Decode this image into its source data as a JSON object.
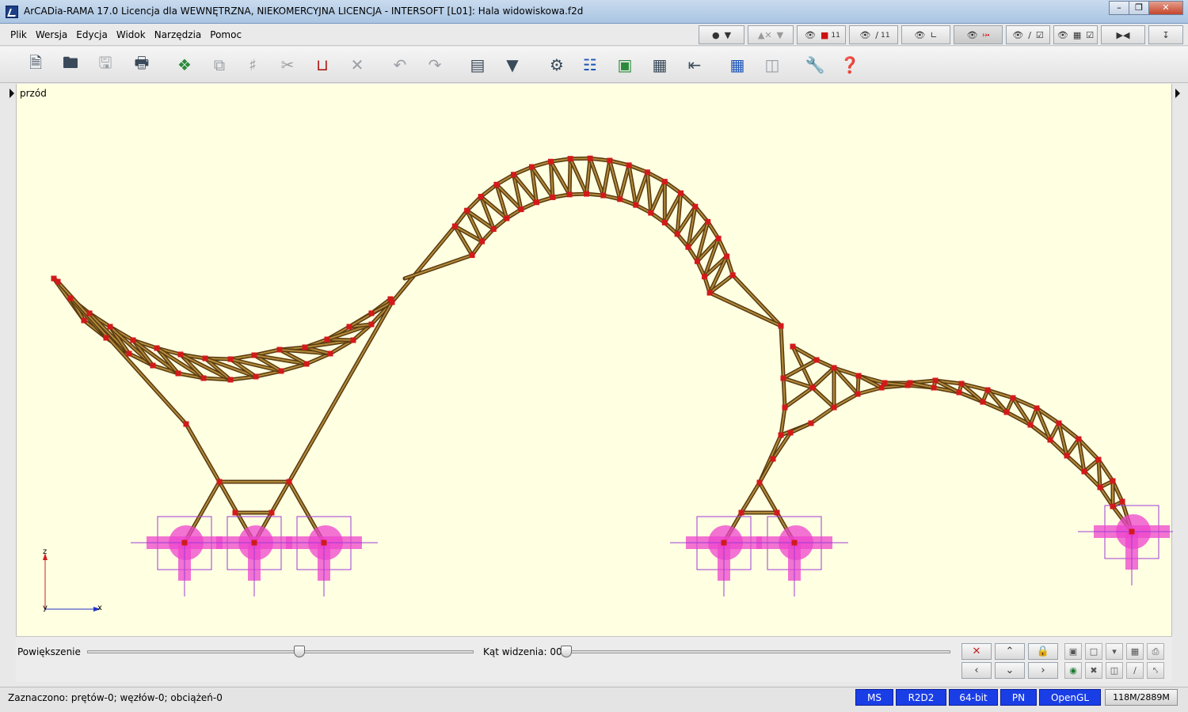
{
  "window": {
    "title": "ArCADia-RAMA 17.0 Licencja dla WEWNĘTRZNA, NIEKOMERCYJNA LICENCJA - INTERSOFT [L01]: Hala widowiskowa.f2d"
  },
  "menu": {
    "items": [
      {
        "label": "Plik"
      },
      {
        "label": "Wersja"
      },
      {
        "label": "Edycja"
      },
      {
        "label": "Widok"
      },
      {
        "label": "Narzędzia"
      },
      {
        "label": "Pomoc"
      }
    ]
  },
  "view_controls": {
    "load_counter": "11",
    "number_label": "11"
  },
  "canvas": {
    "view_name": "przód",
    "axis_z": "z",
    "axis_x": "x",
    "axis_y": "y",
    "colors": {
      "background": "#ffffe1",
      "member": "#5a3a10",
      "member_fill": "#b08a3a",
      "node": "#d21a1a",
      "support": "#ee44cc"
    }
  },
  "controls": {
    "zoom_label": "Powiększenie",
    "angle_label": "Kąt widzenia: 00",
    "zoom_level": 0.55,
    "angle_level": 0.0
  },
  "status": {
    "selection": "Zaznaczono: prętów-0; węzłów-0; obciążeń-0",
    "badges": [
      "MS",
      "R2D2",
      "64-bit",
      "PN",
      "OpenGL"
    ],
    "memory": "118M/2889M"
  }
}
